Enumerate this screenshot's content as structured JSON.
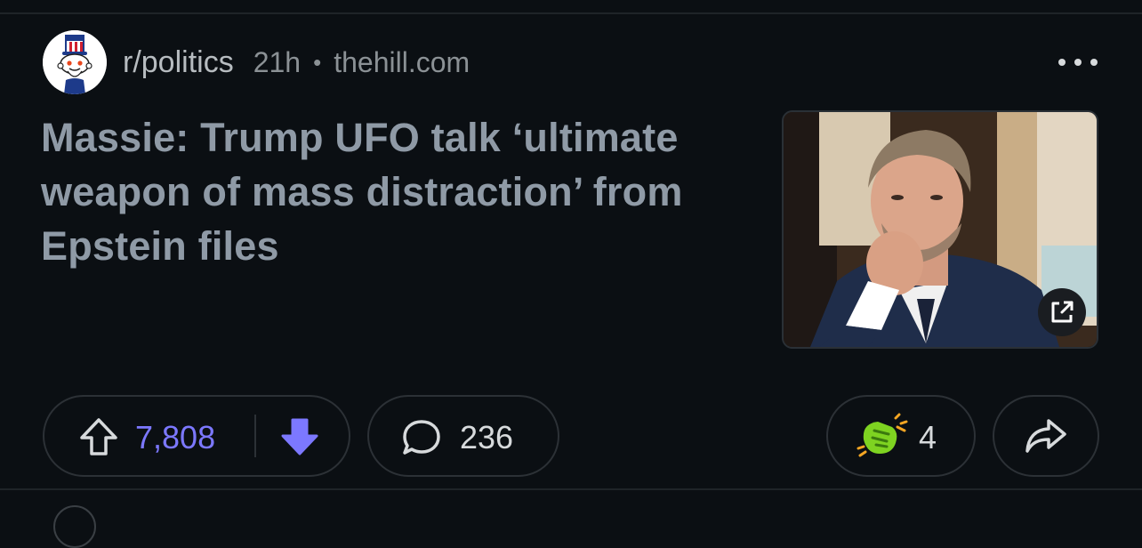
{
  "post": {
    "subreddit": "r/politics",
    "time": "21h",
    "separator": "•",
    "domain": "thehill.com",
    "title": "Massie: Trump UFO talk ‘ultimate weapon of mass distraction’ from Epstein files"
  },
  "icons": {
    "avatar": "uncle-sam-snoo-avatar",
    "more": "more-horizontal-icon",
    "external": "external-link-icon",
    "upvote": "upvote-arrow-icon",
    "downvote": "downvote-arrow-icon",
    "comment": "comment-bubble-icon",
    "award": "award-icon",
    "share": "share-arrow-icon"
  },
  "actions": {
    "votes": "7,808",
    "comments": "236",
    "awards": "4"
  },
  "colors": {
    "background": "#0b0f13",
    "vote_accent": "#7c78ff",
    "title": "#8f9aa6",
    "meta": "#8b9195"
  }
}
